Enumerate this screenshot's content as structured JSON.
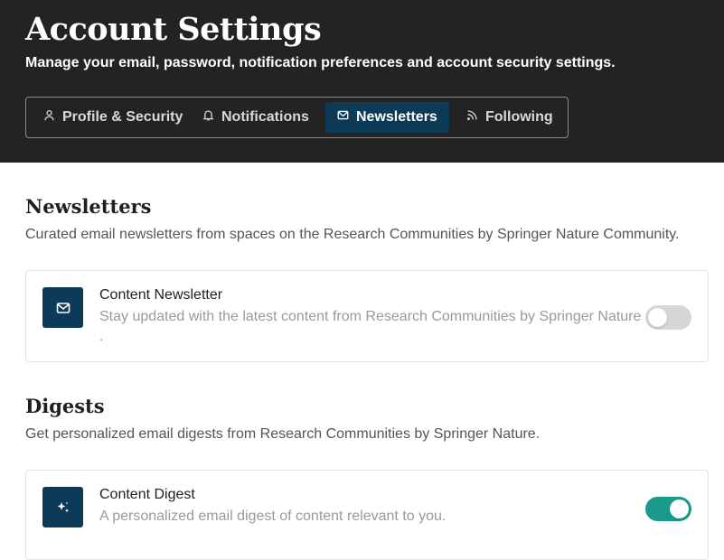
{
  "header": {
    "title": "Account Settings",
    "subtitle": "Manage your email, password, notification preferences and account security settings."
  },
  "tabs": [
    {
      "label": "Profile & Security",
      "icon": "user-icon",
      "active": false
    },
    {
      "label": "Notifications",
      "icon": "bell-icon",
      "active": false
    },
    {
      "label": "Newsletters",
      "icon": "mail-icon",
      "active": true
    },
    {
      "label": "Following",
      "icon": "rss-icon",
      "active": false
    }
  ],
  "newsletters": {
    "title": "Newsletters",
    "description": "Curated email newsletters from spaces on the Research Communities by Springer Nature Community.",
    "items": [
      {
        "title": "Content Newsletter",
        "description": "Stay updated with the latest content from Research Communities by Springer Nature .",
        "icon": "mail-icon",
        "enabled": false
      }
    ]
  },
  "digests": {
    "title": "Digests",
    "description": "Get personalized email digests from Research Communities by Springer Nature.",
    "items": [
      {
        "title": "Content Digest",
        "description": "A personalized email digest of content relevant to you.",
        "icon": "sparkle-icon",
        "enabled": true
      }
    ]
  },
  "colors": {
    "header_bg": "#232323",
    "accent": "#0d3a57",
    "toggle_on": "#1a9a8a",
    "toggle_off": "#d6d6d6"
  }
}
